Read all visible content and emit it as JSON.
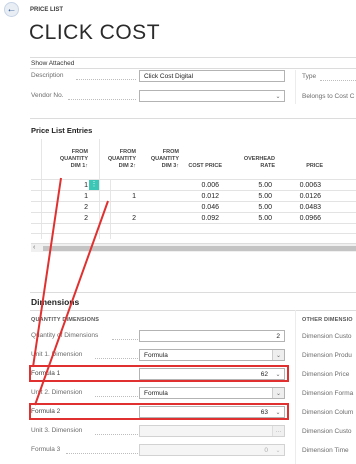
{
  "page": {
    "caption": "PRICE LIST",
    "title": "CLICK COST",
    "show_attached": "Show Attached"
  },
  "header_fields": {
    "description_label": "Description",
    "description_value": "Click Cost Digital",
    "vendor_label": "Vendor No.",
    "vendor_value": "",
    "type_label": "Type",
    "belongs_label": "Belongs to Cost C"
  },
  "price_list_entries": {
    "title": "Price List Entries",
    "columns": [
      "FROM QUANTITY DIM 1↑",
      "FROM QUANTITY DIM 2↑",
      "FROM QUANTITY DIM 3↑",
      "COST PRICE",
      "OVERHEAD RATE",
      "PRICE"
    ],
    "col_lines": [
      [
        "FROM",
        "QUANTITY",
        "DIM 1↑"
      ],
      [
        "FROM",
        "QUANTITY",
        "DIM 2↑"
      ],
      [
        "FROM",
        "QUANTITY",
        "DIM 3↑"
      ],
      [
        "",
        "",
        "COST PRICE"
      ],
      [
        "",
        "OVERHEAD",
        "RATE"
      ],
      [
        "",
        "",
        "PRICE"
      ]
    ],
    "rows": [
      [
        "1",
        "",
        "",
        "0.006",
        "5.00",
        "0.0063"
      ],
      [
        "1",
        "1",
        "",
        "0.012",
        "5.00",
        "0.0126"
      ],
      [
        "2",
        "",
        "",
        "0.046",
        "5.00",
        "0.0483"
      ],
      [
        "2",
        "2",
        "",
        "0.092",
        "5.00",
        "0.0966"
      ]
    ]
  },
  "dimensions": {
    "title": "Dimensions",
    "left_header": "QUANTITY DIMENSIONS",
    "right_header": "OTHER DIMENSIO",
    "fields": [
      {
        "label": "Quantity of Dimensions",
        "value": "2",
        "kind": "number"
      },
      {
        "label": "Unit 1. Dimension",
        "value": "Formula",
        "kind": "select"
      },
      {
        "label": "Formula 1",
        "value": "62",
        "kind": "number-dd"
      },
      {
        "label": "Unit 2. Dimension",
        "value": "Formula",
        "kind": "select"
      },
      {
        "label": "Formula 2",
        "value": "63",
        "kind": "number-dd"
      },
      {
        "label": "Unit 3. Dimension",
        "value": "",
        "kind": "disabled-select"
      },
      {
        "label": "Formula 3",
        "value": "0",
        "kind": "disabled-number-dd"
      }
    ],
    "right_labels": [
      "Dimension Custo",
      "Dimension Produ",
      "Dimension Price",
      "Dimension Forma",
      "Dimension Colum",
      "Dimension Custo",
      "Dimension Time"
    ]
  },
  "colors": {
    "highlight": "#e03030",
    "accent": "#1f4e8c",
    "selected_cell": "#3cc6b6"
  }
}
